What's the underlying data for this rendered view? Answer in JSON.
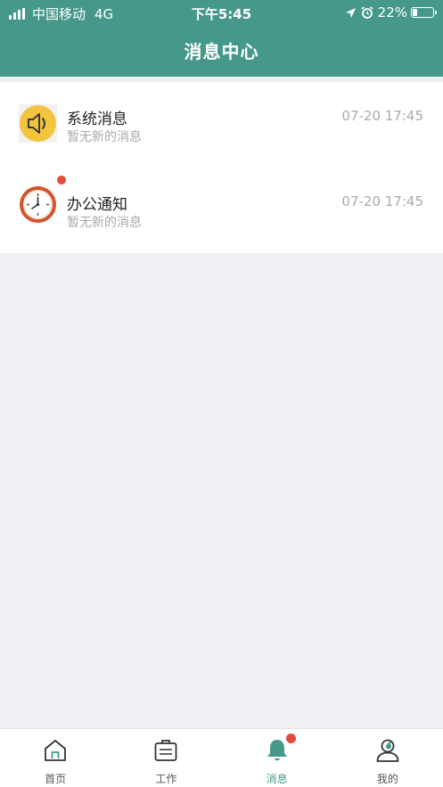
{
  "status_bar": {
    "carrier": "中国移动",
    "network": "4G",
    "time": "下午5:45",
    "battery": "22%",
    "battery_level": 0.22
  },
  "header": {
    "title": "消息中心"
  },
  "messages": [
    {
      "title": "系统消息",
      "subtitle": "暂无新的消息",
      "time": "07-20 17:45",
      "icon": "speaker-icon",
      "unread": false
    },
    {
      "title": "办公通知",
      "subtitle": "暂无新的消息",
      "time": "07-20 17:45",
      "icon": "clock-icon",
      "unread": true
    }
  ],
  "tabbar": {
    "tabs": [
      {
        "label": "首页",
        "icon": "home-icon",
        "active": false
      },
      {
        "label": "工作",
        "icon": "briefcase-icon",
        "active": false
      },
      {
        "label": "消息",
        "icon": "bell-icon",
        "active": true,
        "badge": true
      },
      {
        "label": "我的",
        "icon": "user-icon",
        "active": false
      }
    ]
  },
  "colors": {
    "accent": "#46998a",
    "badge": "#e34b3b",
    "background": "#eff0f4"
  }
}
